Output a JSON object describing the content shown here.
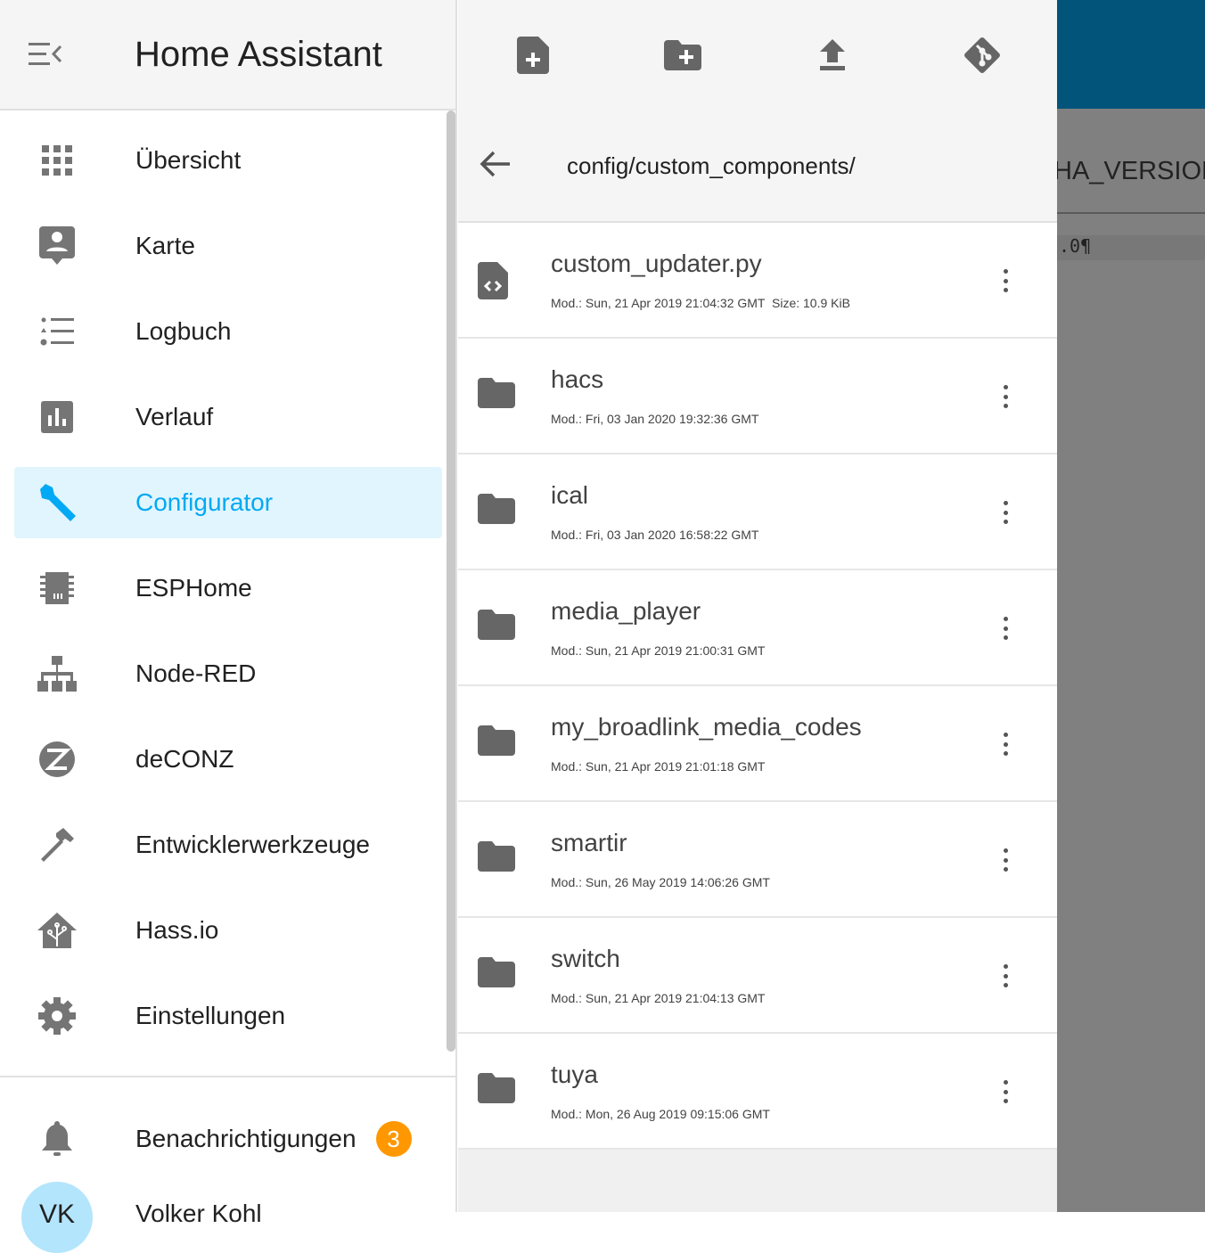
{
  "app_title": "Home Assistant",
  "sidebar": {
    "items": [
      {
        "label": "Übersicht",
        "icon": "grid-icon"
      },
      {
        "label": "Karte",
        "icon": "account-box-icon"
      },
      {
        "label": "Logbuch",
        "icon": "format-list-icon"
      },
      {
        "label": "Verlauf",
        "icon": "chart-bar-icon"
      },
      {
        "label": "Configurator",
        "icon": "wrench-icon",
        "active": true
      },
      {
        "label": "ESPHome",
        "icon": "chip-icon"
      },
      {
        "label": "Node-RED",
        "icon": "sitemap-icon"
      },
      {
        "label": "deCONZ",
        "icon": "zigbee-icon"
      },
      {
        "label": "Entwicklerwerkzeuge",
        "icon": "hammer-icon"
      },
      {
        "label": "Hass.io",
        "icon": "home-assistant-icon"
      },
      {
        "label": "Einstellungen",
        "icon": "gear-icon"
      }
    ],
    "notifications": {
      "label": "Benachrichtigungen",
      "count": "3"
    },
    "user": {
      "initials": "VK",
      "name": "Volker Kohl"
    }
  },
  "browser": {
    "path": "config/custom_components/",
    "files": [
      {
        "name": "custom_updater.py",
        "meta": "Mod.: Sun, 21 Apr 2019 21:04:32 GMT  Size: 10.9 KiB",
        "type": "file"
      },
      {
        "name": "hacs",
        "meta": "Mod.: Fri, 03 Jan 2020 19:32:36 GMT",
        "type": "folder"
      },
      {
        "name": "ical",
        "meta": "Mod.: Fri, 03 Jan 2020 16:58:22 GMT",
        "type": "folder"
      },
      {
        "name": "media_player",
        "meta": "Mod.: Sun, 21 Apr 2019 21:00:31 GMT",
        "type": "folder"
      },
      {
        "name": "my_broadlink_media_codes",
        "meta": "Mod.: Sun, 21 Apr 2019 21:01:18 GMT",
        "type": "folder"
      },
      {
        "name": "smartir",
        "meta": "Mod.: Sun, 26 May 2019 14:06:26 GMT",
        "type": "folder"
      },
      {
        "name": "switch",
        "meta": "Mod.: Sun, 21 Apr 2019 21:04:13 GMT",
        "type": "folder"
      },
      {
        "name": "tuya",
        "meta": "Mod.: Mon, 26 Aug 2019 09:15:06 GMT",
        "type": "folder"
      }
    ]
  },
  "editor": {
    "heading": "HA_VERSION",
    "code": ".0¶"
  },
  "colors": {
    "accent": "#03a9f4",
    "active_bg": "#e1f5fe",
    "badge": "#ff9800",
    "header": "#02547a"
  }
}
